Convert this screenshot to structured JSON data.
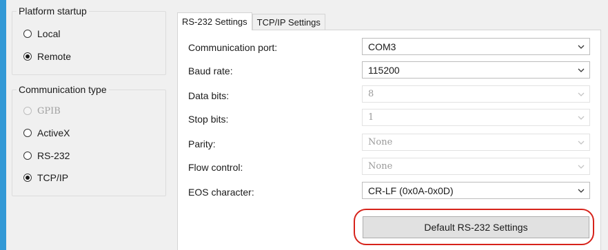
{
  "platform_startup": {
    "title": "Platform startup",
    "options": [
      {
        "label": "Local",
        "checked": false,
        "disabled": false
      },
      {
        "label": "Remote",
        "checked": true,
        "disabled": false
      }
    ]
  },
  "communication_type": {
    "title": "Communication type",
    "options": [
      {
        "label": "GPIB",
        "checked": false,
        "disabled": true
      },
      {
        "label": "ActiveX",
        "checked": false,
        "disabled": false
      },
      {
        "label": "RS-232",
        "checked": false,
        "disabled": false
      },
      {
        "label": "TCP/IP",
        "checked": true,
        "disabled": false
      }
    ]
  },
  "tabs": [
    {
      "label": "RS-232 Settings",
      "active": true
    },
    {
      "label": "TCP/IP Settings",
      "active": false
    }
  ],
  "fields": [
    {
      "label": "Communication port:",
      "value": "COM3",
      "disabled": false
    },
    {
      "label": "Baud rate:",
      "value": "115200",
      "disabled": false
    },
    {
      "label": "Data bits:",
      "value": "8",
      "disabled": true
    },
    {
      "label": "Stop bits:",
      "value": "1",
      "disabled": true
    },
    {
      "label": "Parity:",
      "value": "None",
      "disabled": true
    },
    {
      "label": "Flow control:",
      "value": "None",
      "disabled": true
    },
    {
      "label": "EOS character:",
      "value": "CR-LF (0x0A-0x0D)",
      "disabled": false
    }
  ],
  "default_button": {
    "label": "Default RS-232 Settings"
  },
  "colors": {
    "highlight": "#d6221a",
    "accent_strip": "#3399d6"
  },
  "icons": {
    "dropdown": "chevron-down-icon",
    "radio": "radio-button-icon"
  }
}
